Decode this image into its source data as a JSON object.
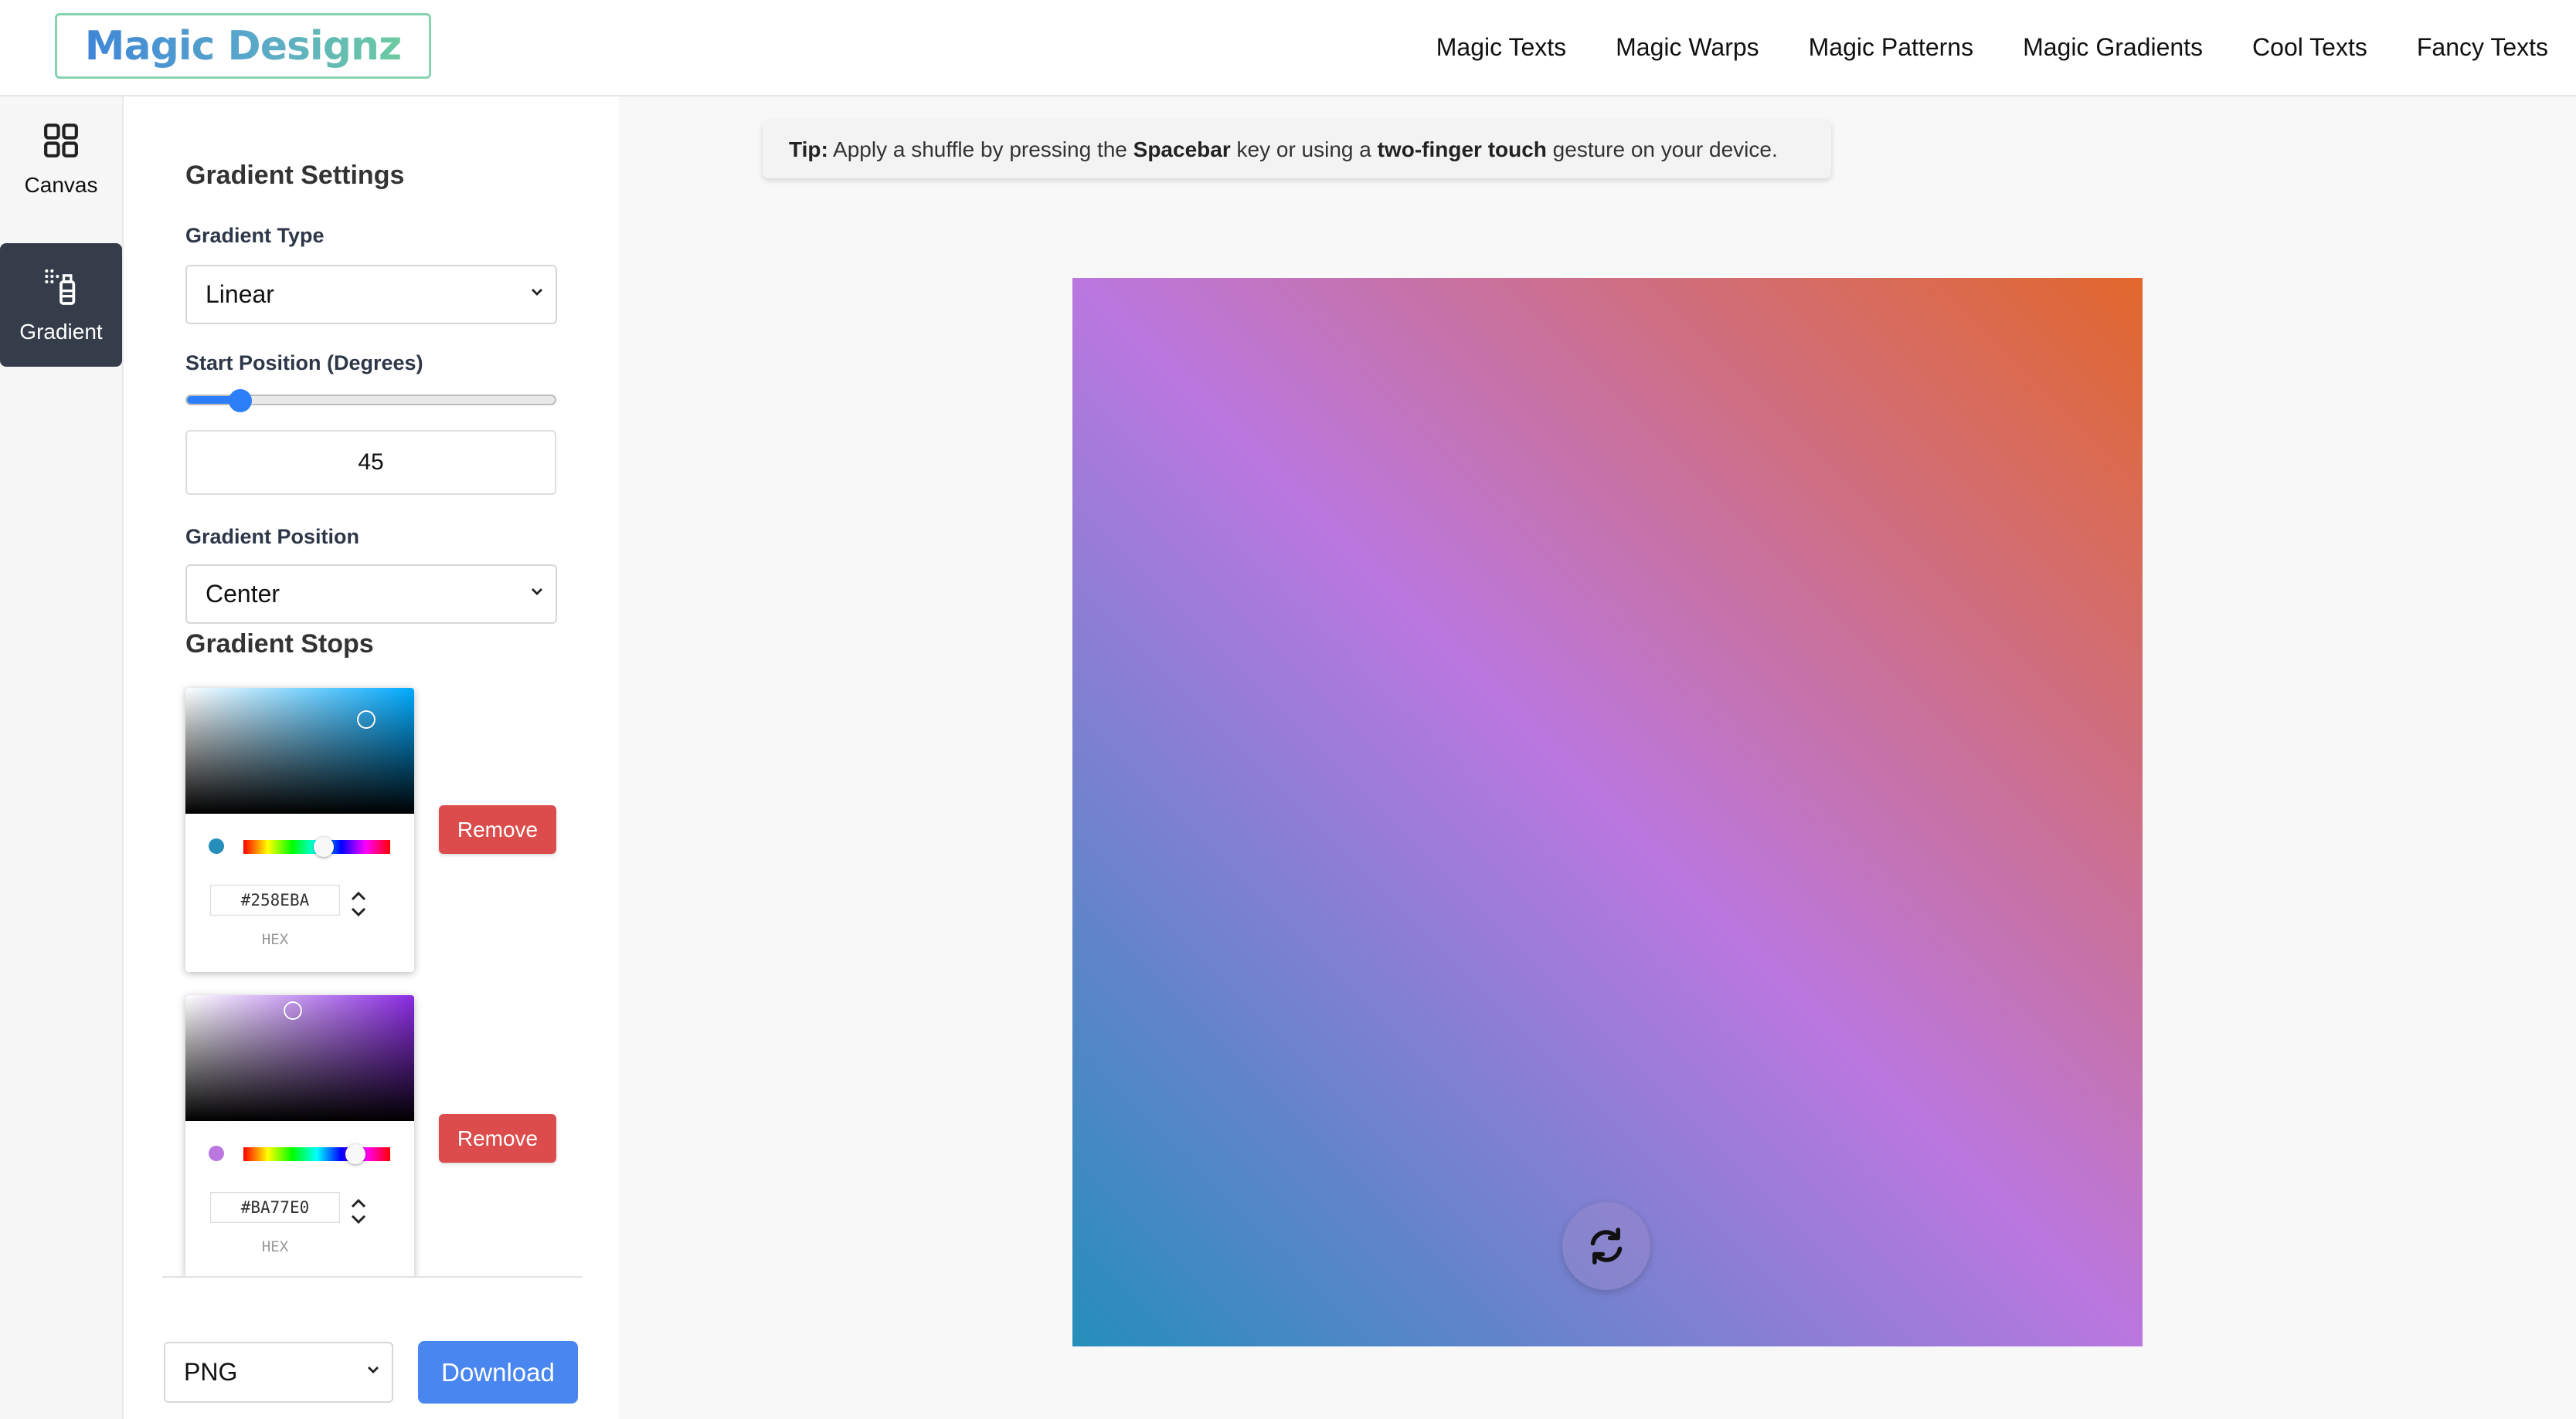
{
  "header": {
    "logo": "Magic Designz",
    "nav": [
      "Magic Texts",
      "Magic Warps",
      "Magic Patterns",
      "Magic Gradients",
      "Cool Texts",
      "Fancy Texts"
    ]
  },
  "rail": {
    "canvas_label": "Canvas",
    "gradient_label": "Gradient"
  },
  "panel": {
    "title": "Gradient Settings",
    "type_label": "Gradient Type",
    "type_value": "Linear",
    "start_label": "Start Position (Degrees)",
    "start_value": "45",
    "start_fraction": 0.125,
    "position_label": "Gradient Position",
    "position_value": "Center",
    "stops_title": "Gradient Stops",
    "stops": [
      {
        "hex": "#258EBA",
        "format": "HEX",
        "remove_label": "Remove",
        "hue_color": "#00aaff"
      },
      {
        "hex": "#BA77E0",
        "format": "HEX",
        "remove_label": "Remove",
        "hue_color": "#8a2be2"
      }
    ],
    "export_format": "PNG",
    "download_label": "Download"
  },
  "tip": {
    "prefix": "Tip:",
    "t1": " Apply a shuffle by pressing the ",
    "k1": "Spacebar",
    "t2": " key or using a ",
    "k2": "two-finger touch",
    "t3": " gesture on your device."
  },
  "canvas": {
    "angle_deg": 45,
    "colors": [
      "#258EBA",
      "#BA77E0",
      "#E2672C"
    ]
  },
  "colors": {
    "accent": "#4a86f0",
    "danger": "#dc4c4c",
    "rail_active": "#353d4b"
  }
}
